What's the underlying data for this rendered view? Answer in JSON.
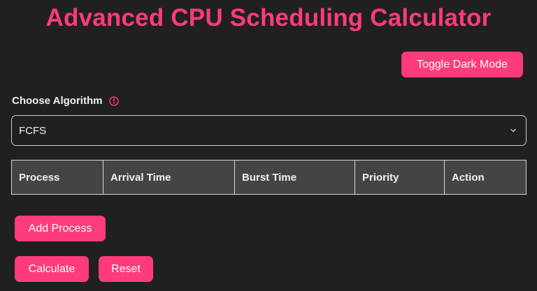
{
  "header": {
    "title": "Advanced CPU Scheduling Calculator"
  },
  "toolbar": {
    "toggle_dark_mode_label": "Toggle Dark Mode"
  },
  "algorithm": {
    "label": "Choose Algorithm",
    "info_icon": "info-circle-icon",
    "selected": "FCFS",
    "dropdown_icon": "chevron-down-icon"
  },
  "table": {
    "columns": [
      "Process",
      "Arrival Time",
      "Burst Time",
      "Priority",
      "Action"
    ],
    "rows": []
  },
  "actions": {
    "add_process_label": "Add Process",
    "calculate_label": "Calculate",
    "reset_label": "Reset"
  },
  "colors": {
    "accent": "#ff3b7a",
    "background": "#202020",
    "table_header_bg": "#444444"
  }
}
